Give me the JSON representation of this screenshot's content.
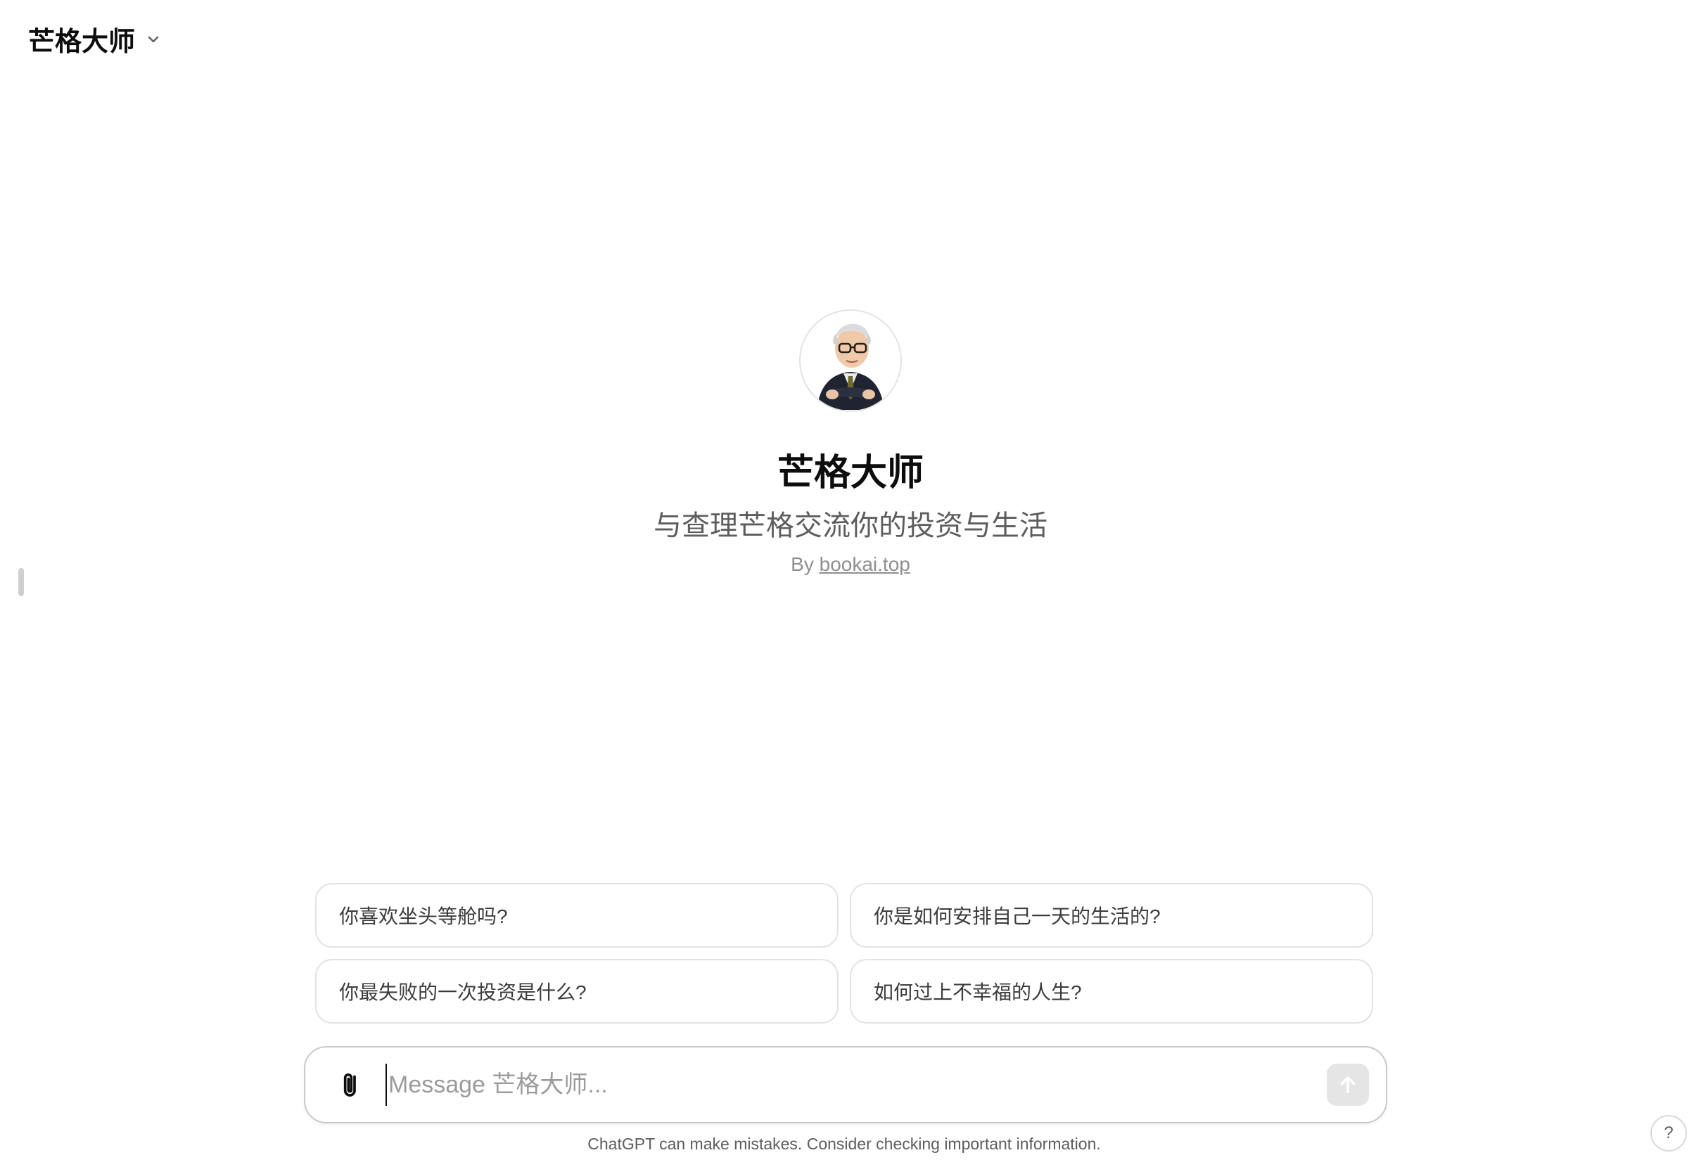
{
  "header": {
    "model_name": "芒格大师"
  },
  "gpt": {
    "name": "芒格大师",
    "description": "与查理芒格交流你的投资与生活",
    "by_prefix": "By",
    "by_link": "bookai.top"
  },
  "suggestions": [
    "你喜欢坐头等舱吗?",
    "你是如何安排自己一天的生活的?",
    "你最失败的一次投资是什么?",
    "如何过上不幸福的人生?"
  ],
  "composer": {
    "placeholder": "Message 芒格大师..."
  },
  "disclaimer": "ChatGPT can make mistakes. Consider checking important information.",
  "help": {
    "label": "?"
  },
  "icons": {
    "chevron": "chevron-down-icon",
    "attach": "paperclip-icon",
    "send": "arrow-up-icon"
  },
  "colors": {
    "text_primary": "#0d0d0d",
    "text_secondary": "#5d5d5d",
    "border": "#e3e3e3",
    "send_disabled": "#e5e5e5"
  }
}
